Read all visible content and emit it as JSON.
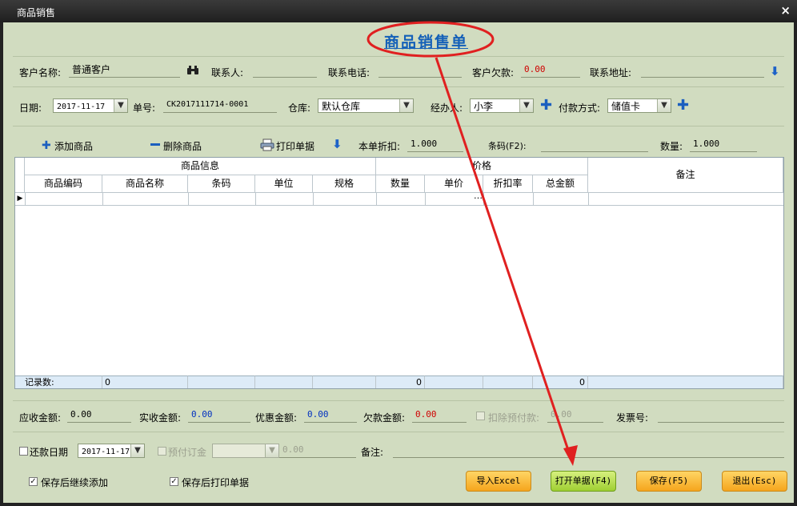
{
  "window": {
    "title": "商品销售",
    "close_glyph": "×"
  },
  "heading": "商品销售单",
  "row1": {
    "customer_label": "客户名称:",
    "customer_value": "普通客户",
    "contact_label": "联系人:",
    "contact_value": "",
    "phone_label": "联系电话:",
    "phone_value": "",
    "debt_label": "客户欠款:",
    "debt_value": "0.00",
    "address_label": "联系地址:",
    "address_value": ""
  },
  "row2": {
    "date_label": "日期:",
    "date_value": "2017-11-17",
    "order_label": "单号:",
    "order_value": "CK2017111714-0001",
    "warehouse_label": "仓库:",
    "warehouse_value": "默认仓库",
    "agent_label": "经办人:",
    "agent_value": "小李",
    "payment_label": "付款方式:",
    "payment_value": "储值卡"
  },
  "toolbar": {
    "add_label": "添加商品",
    "delete_label": "删除商品",
    "print_label": "打印单据",
    "discount_label": "本单折扣:",
    "discount_value": "1.000",
    "barcode_label": "条码(F2):",
    "barcode_value": "",
    "qty_label": "数量:",
    "qty_value": "1.000"
  },
  "grid": {
    "group_product": "商品信息",
    "group_price": "价格",
    "remark_header": "备注",
    "columns": [
      "商品编码",
      "商品名称",
      "条码",
      "单位",
      "规格",
      "数量",
      "单价",
      "折扣率",
      "总金额"
    ],
    "cell_ellipsis": "…",
    "footer_label": "记录数:",
    "footer_count": "0",
    "footer_qty": "0",
    "footer_total": "0"
  },
  "amounts": {
    "receivable_label": "应收金额:",
    "receivable_value": "0.00",
    "received_label": "实收金额:",
    "received_value": "0.00",
    "discount_label": "优惠金额:",
    "discount_value": "0.00",
    "owed_label": "欠款金额:",
    "owed_value": "0.00",
    "deduct_label": "扣除预付款:",
    "deduct_value": "0.00",
    "invoice_label": "发票号:",
    "invoice_value": ""
  },
  "row_repay": {
    "repay_label": "还款日期",
    "repay_date": "2017-11-17",
    "prepay_label": "预付订金",
    "prepay_combo": "",
    "prepay_value": "0.00",
    "remark_label": "备注:",
    "remark_value": ""
  },
  "bottom": {
    "continue_label": "保存后继续添加",
    "print_after_label": "保存后打印单据",
    "import_btn": "导入Excel",
    "open_btn": "打开单据(F4)",
    "save_btn": "保存(F5)",
    "exit_btn": "退出(Esc)"
  },
  "colors": {
    "client_bg": "#d1dcc0",
    "accent_blue": "#1b5fbf",
    "annotation_red": "#e02020"
  }
}
